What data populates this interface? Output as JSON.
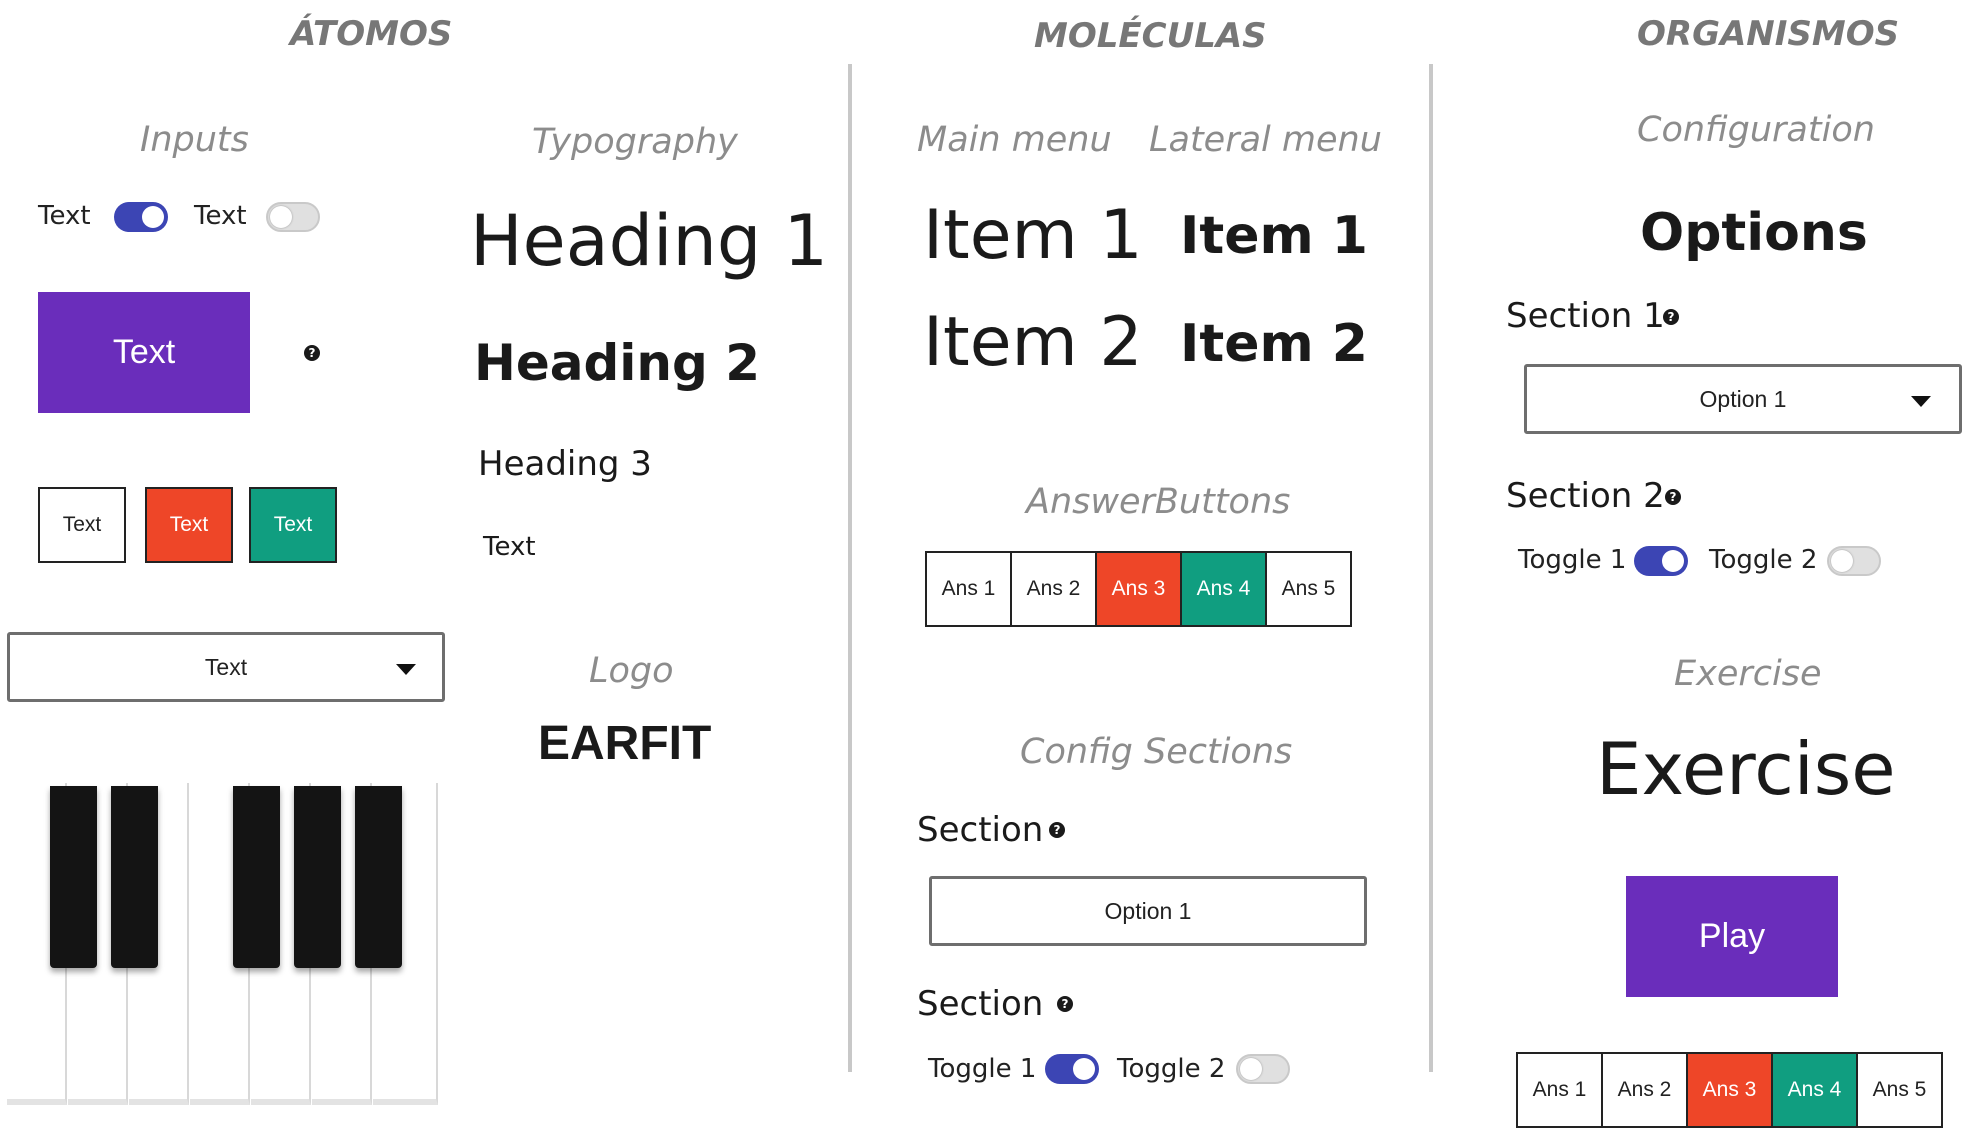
{
  "columns": {
    "atoms": "ÁTOMOS",
    "molecules": "MOLÉCULAS",
    "organisms": "ORGANISMOS"
  },
  "atoms": {
    "inputs_title": "Inputs",
    "toggle_a_label": "Text",
    "toggle_a_on": true,
    "toggle_b_label": "Text",
    "toggle_b_on": false,
    "primary_button": "Text",
    "help_glyph": "?",
    "small_buttons": [
      "Text",
      "Text",
      "Text"
    ],
    "select_value": "Text",
    "typography_title": "Typography",
    "heading1": "Heading 1",
    "heading2": "Heading 2",
    "heading3": "Heading 3",
    "body_text": "Text",
    "logo_title": "Logo",
    "logo": "EARFIT"
  },
  "molecules": {
    "main_menu_title": "Main menu",
    "lateral_menu_title": "Lateral menu",
    "main_items": [
      "Item 1",
      "Item 2"
    ],
    "lateral_items": [
      "Item 1",
      "Item 2"
    ],
    "answer_buttons_title": "AnswerButtons",
    "answers": [
      "Ans 1",
      "Ans 2",
      "Ans 3",
      "Ans 4",
      "Ans 5"
    ],
    "config_sections_title": "Config Sections",
    "section_a_label": "Section",
    "section_a_select": "Option 1",
    "section_b_label": "Section",
    "toggle1_label": "Toggle 1",
    "toggle1_on": true,
    "toggle2_label": "Toggle 2",
    "toggle2_on": false
  },
  "organisms": {
    "configuration_title": "Configuration",
    "options_heading": "Options",
    "section1_label": "Section 1",
    "section1_select": "Option 1",
    "section2_label": "Section 2",
    "toggle1_label": "Toggle 1",
    "toggle1_on": true,
    "toggle2_label": "Toggle 2",
    "toggle2_on": false,
    "exercise_title": "Exercise",
    "exercise_heading": "Exercise",
    "play_button": "Play",
    "answers": [
      "Ans 1",
      "Ans 2",
      "Ans 3",
      "Ans 4",
      "Ans 5"
    ]
  },
  "colors": {
    "purple": "#6a2dbb",
    "red": "#ee4628",
    "green": "#109e80",
    "toggle_on": "#3c45b4",
    "divider": "#c8c8c8"
  },
  "icons": [
    "help-icon",
    "chevron-down-icon"
  ]
}
